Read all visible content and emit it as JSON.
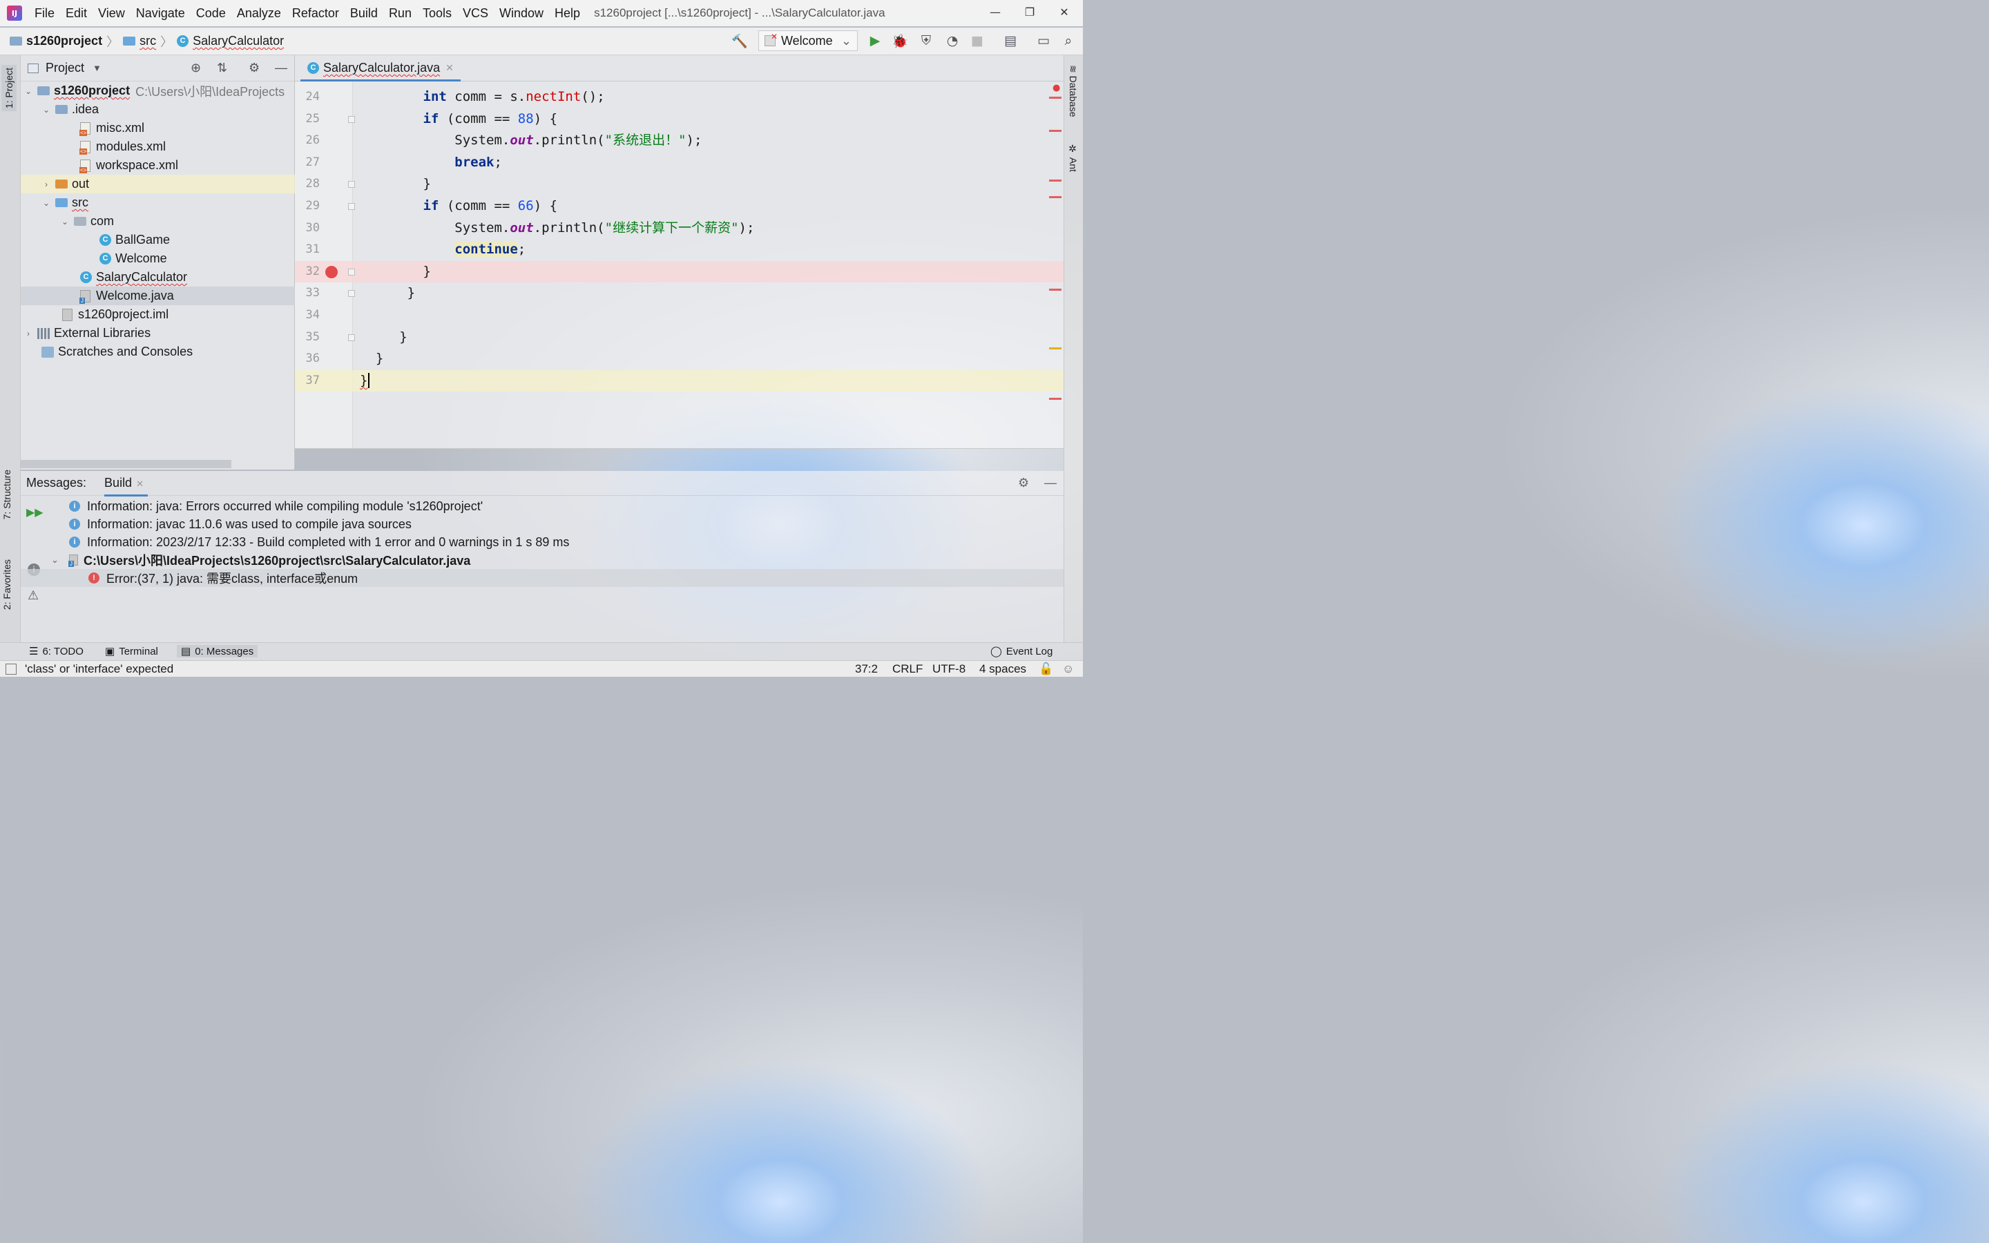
{
  "window": {
    "title": "s1260project [...\\s1260project] - ...\\SalaryCalculator.java",
    "controls": {
      "minimize": "—",
      "restore": "❐",
      "close": "✕"
    }
  },
  "menu": [
    "File",
    "Edit",
    "View",
    "Navigate",
    "Code",
    "Analyze",
    "Refactor",
    "Build",
    "Run",
    "Tools",
    "VCS",
    "Window",
    "Help"
  ],
  "breadcrumb": {
    "project": "s1260project",
    "folder": "src",
    "file": "SalaryCalculator"
  },
  "run_config": {
    "label": "Welcome"
  },
  "left_tool_tabs": {
    "project": "1: Project",
    "structure": "7: Structure",
    "favorites": "2: Favorites"
  },
  "right_tool_tabs": {
    "database": "Database",
    "ant": "Ant"
  },
  "project_panel": {
    "title": "Project",
    "root": {
      "name": "s1260project",
      "path": "C:\\Users\\小阳\\IdeaProjects"
    },
    "items": [
      {
        "label": ".idea"
      },
      {
        "label": "misc.xml"
      },
      {
        "label": "modules.xml"
      },
      {
        "label": "workspace.xml"
      },
      {
        "label": "out"
      },
      {
        "label": "src"
      },
      {
        "label": "com"
      },
      {
        "label": "BallGame"
      },
      {
        "label": "Welcome"
      },
      {
        "label": "SalaryCalculator"
      },
      {
        "label": "Welcome.java"
      },
      {
        "label": "s1260project.iml"
      },
      {
        "label": "External Libraries"
      },
      {
        "label": "Scratches and Consoles"
      }
    ]
  },
  "editor": {
    "tab_label": "SalaryCalculator.java",
    "current_line": 37,
    "breakpoint_line": 32
  },
  "messages_panel": {
    "label": "Messages:",
    "tab": "Build",
    "rows": [
      {
        "text": "Information: java: Errors occurred while compiling module 's1260project'"
      },
      {
        "text": "Information: javac 11.0.6 was used to compile java sources"
      },
      {
        "text": "Information: 2023/2/17 12:33 - Build completed with 1 error and 0 warnings in 1 s 89 ms"
      },
      {
        "text": "C:\\Users\\小阳\\IdeaProjects\\s1260project\\src\\SalaryCalculator.java"
      },
      {
        "text": "Error:(37, 1)  java: 需要class, interface或enum"
      }
    ]
  },
  "bottom_tabs": {
    "todo": "6: TODO",
    "terminal": "Terminal",
    "messages": "0: Messages",
    "event_log": "Event Log"
  },
  "status": {
    "message": "'class' or 'interface' expected",
    "position": "37:2",
    "line_sep": "CRLF",
    "encoding": "UTF-8",
    "indent": "4 spaces"
  },
  "colors": {
    "accent": "#4a86c8",
    "error": "#e05555",
    "keyword": "#0a2e8a",
    "string": "#067d17",
    "number": "#1750eb"
  }
}
